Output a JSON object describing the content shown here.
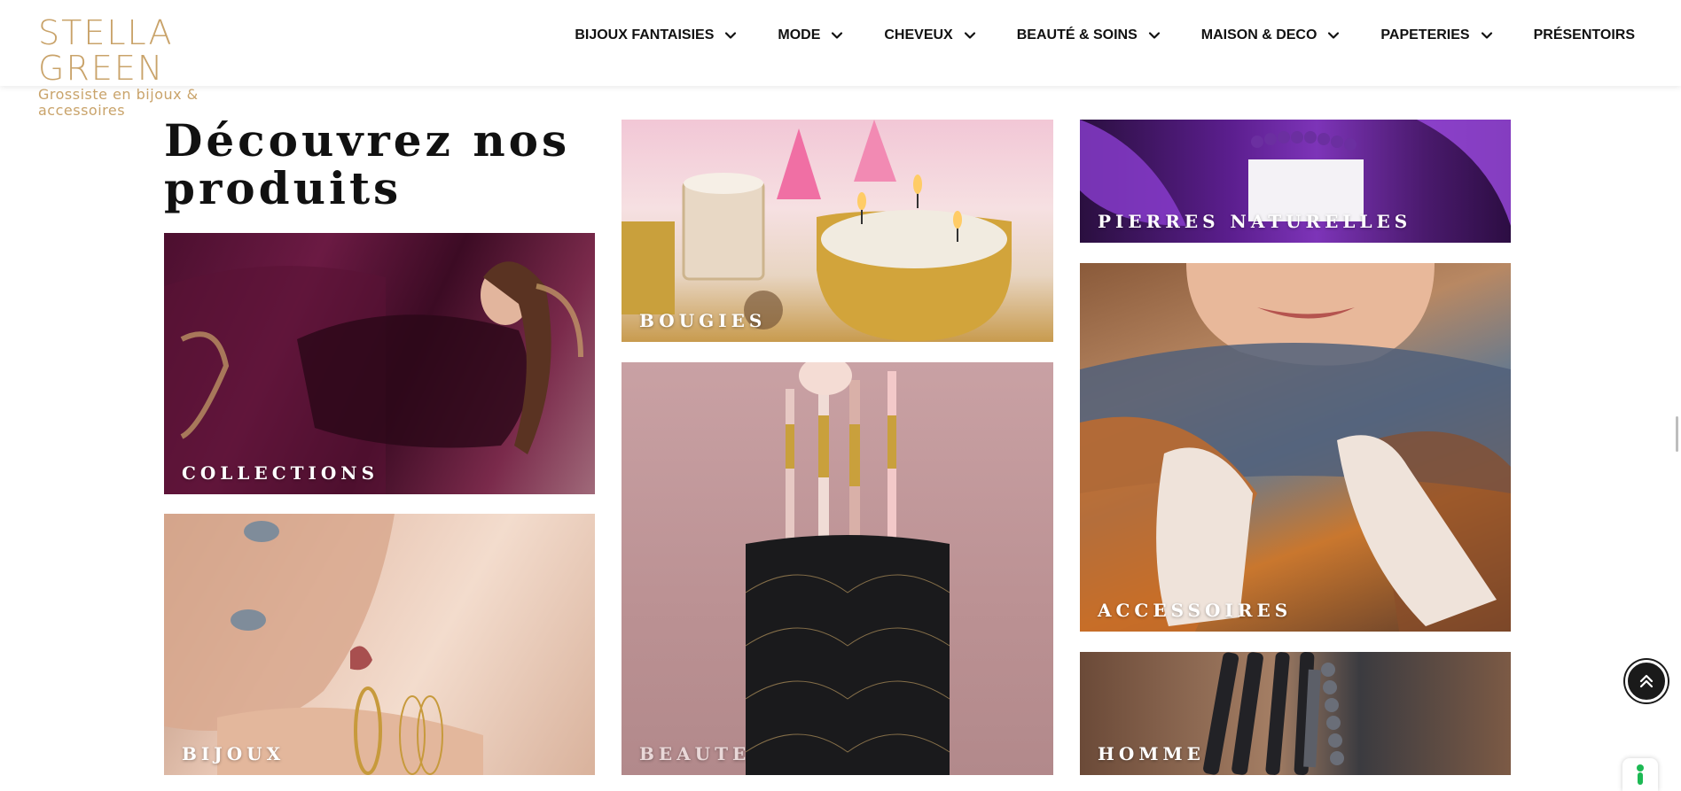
{
  "brand": {
    "title": "STELLA GREEN",
    "subtitle": "Grossiste en bijoux & accessoires",
    "color": "#c9a36a"
  },
  "nav": {
    "items": [
      {
        "label": "BIJOUX FANTAISIES",
        "icon": "chevron-down-icon"
      },
      {
        "label": "MODE",
        "icon": "chevron-down-icon"
      },
      {
        "label": "CHEVEUX",
        "icon": "chevron-down-icon"
      },
      {
        "label": "BEAUTÉ & SOINS",
        "icon": "chevron-down-icon"
      },
      {
        "label": "MAISON & DECO",
        "icon": "chevron-down-icon"
      },
      {
        "label": "PAPETERIES",
        "icon": "chevron-down-icon"
      },
      {
        "label": "PRÉSENTOIRS"
      }
    ]
  },
  "section": {
    "heading": "Découvrez nos produits"
  },
  "categories": {
    "collections": "COLLECTIONS",
    "bijoux": "BIJOUX",
    "bougies": "BOUGIES",
    "beaute": "BEAUTE",
    "pierres": "PIERRES NATURELLES",
    "accessoires": "ACCESSOIRES",
    "homme": "HOMME"
  },
  "widgets": {
    "scroll_top_icon": "double-chevron-up-icon",
    "accessibility_icon": "accessibility-icon",
    "accent": "#1a1a1a"
  }
}
